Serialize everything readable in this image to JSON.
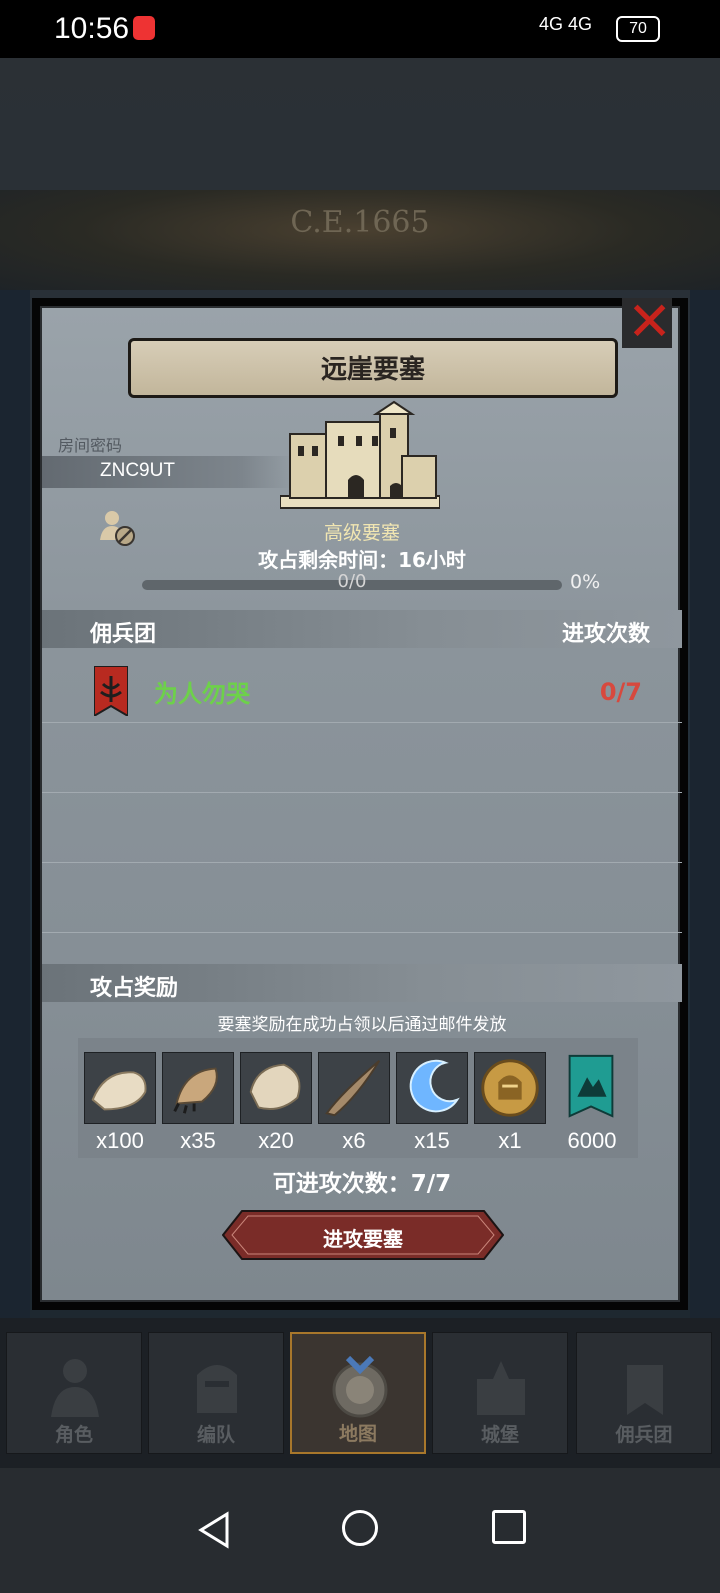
{
  "status_bar": {
    "time": "10:56",
    "signal": "4G 4G",
    "battery": "70"
  },
  "background": {
    "year": "C.E.1665"
  },
  "dialog": {
    "title": "远崖要塞",
    "room_label": "房间密码",
    "room_code": "ZNC9UT",
    "fort_type": "高级要塞",
    "remaining_time": "攻占剩余时间：16小时",
    "progress": {
      "text": "0/0",
      "percent": "0%",
      "fraction": 0
    },
    "mercenary_header": {
      "left": "佣兵团",
      "right": "进攻次数"
    },
    "mercenaries": [
      {
        "name": "为人勿哭",
        "attacks": "0/7"
      }
    ],
    "reward_header": "攻占奖励",
    "reward_note": "要塞奖励在成功占领以后通过邮件发放",
    "rewards": [
      {
        "icon": "hide-icon",
        "qty": "x100"
      },
      {
        "icon": "claw-icon",
        "qty": "x35"
      },
      {
        "icon": "scale-icon",
        "qty": "x20"
      },
      {
        "icon": "horn-icon",
        "qty": "x6"
      },
      {
        "icon": "crescent-icon",
        "qty": "x15"
      },
      {
        "icon": "knight-coin-icon",
        "qty": "x1"
      },
      {
        "icon": "guild-banner-icon",
        "qty": "6000"
      }
    ],
    "attempts_left": "可进攻次数：7/7",
    "attack_button": "进攻要塞"
  },
  "bottom_nav": [
    {
      "label": "角色",
      "active": false
    },
    {
      "label": "编队",
      "active": false
    },
    {
      "label": "地图",
      "active": true
    },
    {
      "label": "城堡",
      "active": false
    },
    {
      "label": "佣兵团",
      "active": false
    }
  ],
  "colors": {
    "accent_green": "#6dd14a",
    "accent_red": "#d7493e",
    "close_red": "#c8231c"
  }
}
